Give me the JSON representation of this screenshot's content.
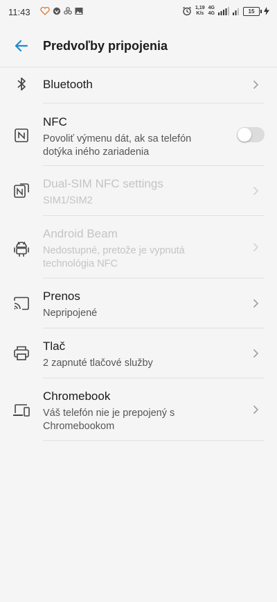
{
  "status_bar": {
    "time": "11:43",
    "speed_value": "1,19",
    "speed_unit": "K/s",
    "network_1": "4G",
    "network_2": "4G",
    "battery": "15"
  },
  "header": {
    "title": "Predvoľby pripojenia"
  },
  "items": [
    {
      "title": "Bluetooth",
      "subtitle": "",
      "icon": "bluetooth-icon",
      "enabled": true
    },
    {
      "title": "NFC",
      "subtitle": "Povoliť výmenu dát, ak sa telefón dotýka iného zariadenia",
      "icon": "nfc-icon",
      "enabled": true,
      "toggle_on": false
    },
    {
      "title": "Dual-SIM NFC settings",
      "subtitle": "SIM1/SIM2",
      "icon": "dual-sim-nfc-icon",
      "enabled": false
    },
    {
      "title": "Android Beam",
      "subtitle": "Nedostupné, pretože je vypnutá technológia NFC",
      "icon": "android-icon",
      "enabled": false
    },
    {
      "title": "Prenos",
      "subtitle": "Nepripojené",
      "icon": "cast-icon",
      "enabled": true
    },
    {
      "title": "Tlač",
      "subtitle": "2 zapnuté tlačové služby",
      "icon": "print-icon",
      "enabled": true
    },
    {
      "title": "Chromebook",
      "subtitle": "Váš telefón nie je prepojený s Chromebookom",
      "icon": "devices-icon",
      "enabled": true
    }
  ],
  "colors": {
    "accent": "#1a8ccf",
    "background": "#f5f5f5",
    "disabled_text": "#c4c4c4"
  }
}
